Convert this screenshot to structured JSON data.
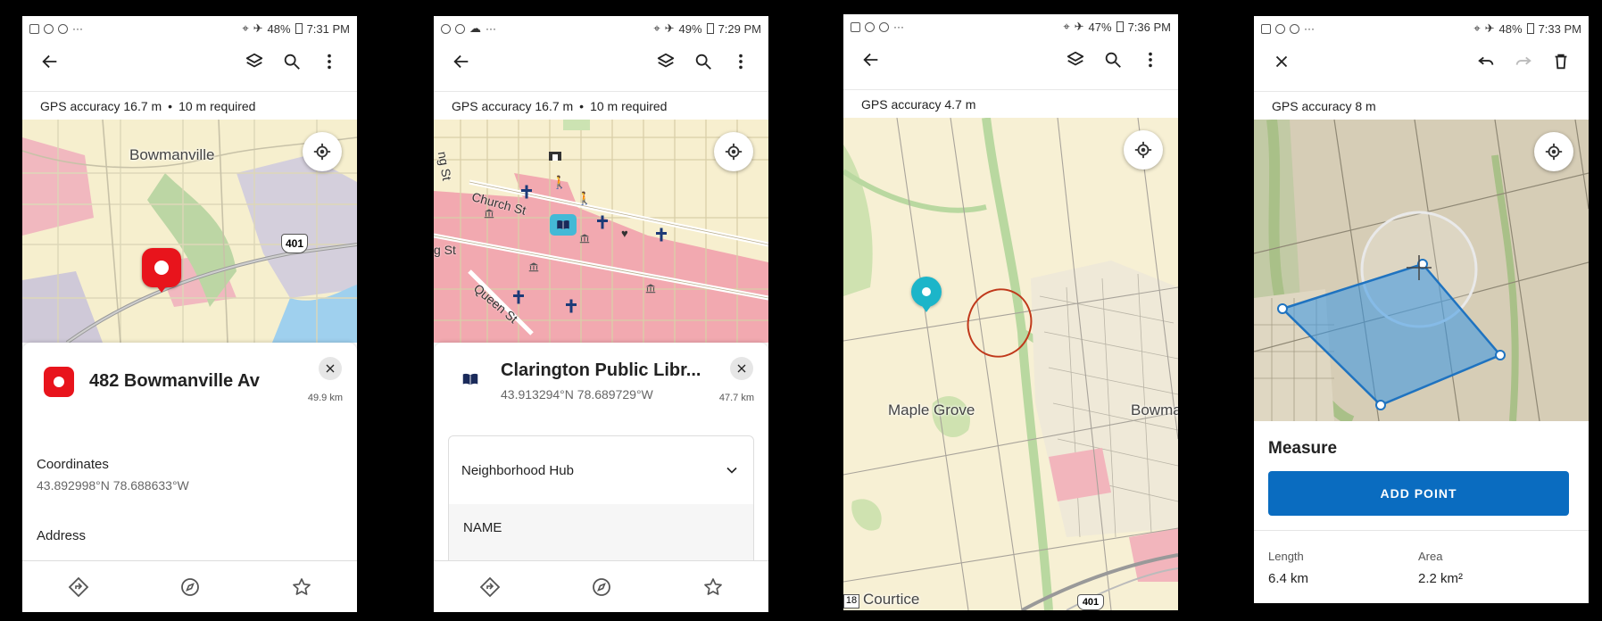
{
  "screen1": {
    "status": {
      "time": "7:31 PM",
      "battery": "48%"
    },
    "gps": {
      "text": "GPS accuracy 16.7 m",
      "sep": "•",
      "required": "10 m required"
    },
    "map": {
      "town_label": "Bowmanville",
      "highway_shield": "401"
    },
    "feature": {
      "title": "482 Bowmanville Av",
      "distance": "49.9 km"
    },
    "coordinates": {
      "label": "Coordinates",
      "value": "43.892998°N 78.688633°W"
    },
    "address": {
      "label": "Address"
    }
  },
  "screen2": {
    "status": {
      "time": "7:29 PM",
      "battery": "49%"
    },
    "gps": {
      "text": "GPS accuracy 16.7 m",
      "sep": "•",
      "required": "10 m required"
    },
    "map": {
      "street1": "Church St",
      "street2": "g St",
      "street3": "Queen St",
      "street4": "ng St"
    },
    "feature": {
      "title": "Clarington Public Libr...",
      "coords": "43.913294°N 78.689729°W",
      "distance": "47.7 km"
    },
    "dropdown": {
      "value": "Neighborhood Hub"
    },
    "field": {
      "label": "NAME"
    }
  },
  "screen3": {
    "status": {
      "time": "7:36 PM",
      "battery": "47%"
    },
    "gps": {
      "text": "GPS accuracy 4.7 m"
    },
    "map": {
      "label1": "Maple Grove",
      "label2": "Bowmar",
      "label3": "Courtice",
      "shield": "401",
      "shield2": "18"
    }
  },
  "screen4": {
    "status": {
      "time": "7:33 PM",
      "battery": "48%"
    },
    "gps": {
      "text": "GPS accuracy 8 m"
    },
    "measure": {
      "title": "Measure",
      "button": "ADD POINT",
      "length_label": "Length",
      "length_value": "6.4 km",
      "area_label": "Area",
      "area_value": "2.2 km²"
    }
  },
  "colors": {
    "accent": "#0a6cc0",
    "pin_red": "#e8141c",
    "pin_teal": "#1cb5c9",
    "urban_pink": "#f2a9b0",
    "map_beige": "#f7efcf"
  }
}
